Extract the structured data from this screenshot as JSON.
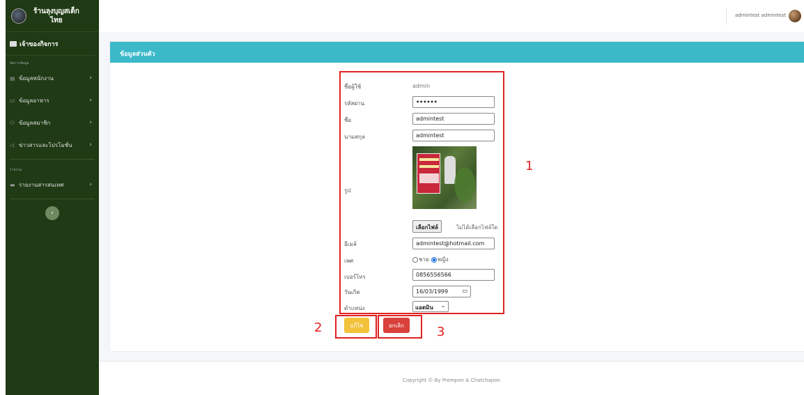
{
  "brand": {
    "name_line1": "ร้านลุงบุญสเต็ก",
    "name_line2": "ไทย"
  },
  "sidebar": {
    "owner_label": "เจ้าของกิจการ",
    "section1": "จัดการข้อมูล",
    "items": [
      {
        "label": "ข้อมูลพนักงาน",
        "icon": "id-card-icon"
      },
      {
        "label": "ข้อมูลอาหาร",
        "icon": "food-icon"
      },
      {
        "label": "ข้อมูลสมาชิก",
        "icon": "members-icon"
      },
      {
        "label": "ข่าวสารและโปรโมชั่น",
        "icon": "megaphone-icon"
      }
    ],
    "section2": "รายงาน",
    "report_item": {
      "label": "รายงานสารสนเทศ",
      "icon": "folder-icon"
    },
    "collapse_glyph": "‹"
  },
  "topbar": {
    "user_name": "admintest admintest"
  },
  "card": {
    "title": "ข้อมูลส่วนตัว"
  },
  "form": {
    "username_label": "ชื่อผู้ใช้",
    "username_value": "admin",
    "password_label": "รหัสผ่าน",
    "password_value": "••••••",
    "firstname_label": "ชื่อ",
    "firstname_value": "admintest",
    "lastname_label": "นามสกุล",
    "lastname_value": "admintest",
    "photo_label": "รูป",
    "file_button": "เลือกไฟล์",
    "file_note": "ไม่ได้เลือกไฟล์ใด",
    "email_label": "อีเมล์",
    "email_value": "admintest@hotmail.com",
    "gender_label": "เพศ",
    "gender_male": "ชาย",
    "gender_female": "หญิง",
    "gender_selected": "หญิง",
    "phone_label": "เบอร์โทร",
    "phone_value": "0856556566",
    "birthdate_label": "วันเกิด",
    "birthdate_value": "16/03/1999",
    "position_label": "ตำแหน่ง",
    "position_value": "แอดมิน"
  },
  "buttons": {
    "edit": "แก้ไข",
    "cancel": "ยกเลิก"
  },
  "annotations": {
    "n1": "1",
    "n2": "2",
    "n3": "3"
  },
  "footer": {
    "text": "Copyright © By Prempon & Chatchapon"
  },
  "colors": {
    "sidebar": "#1f3a14",
    "header": "#3cb9c9",
    "edit": "#f2c23b",
    "cancel": "#d9413a",
    "annotation": "#e02020"
  }
}
